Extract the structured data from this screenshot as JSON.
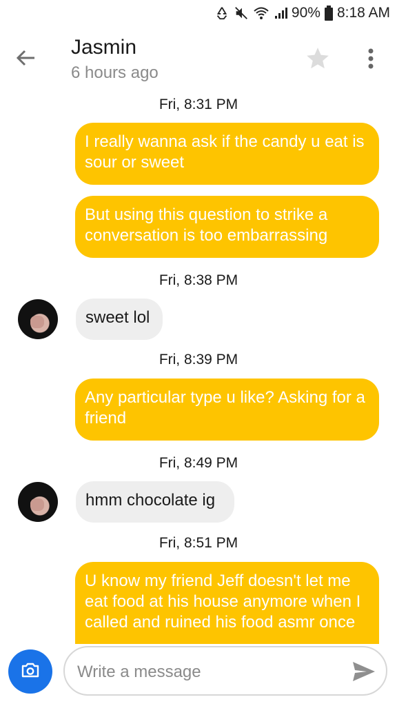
{
  "status_bar": {
    "battery": "90%",
    "time": "8:18 AM"
  },
  "header": {
    "contact_name": "Jasmin",
    "last_seen": "6 hours ago"
  },
  "messages": [
    {
      "type": "timestamp",
      "text": "Fri, 8:31 PM"
    },
    {
      "type": "outgoing",
      "text": "I really wanna ask if the candy u eat is sour or sweet"
    },
    {
      "type": "outgoing",
      "text": "But using this question to strike a conversation is too embarrassing"
    },
    {
      "type": "timestamp",
      "text": "Fri, 8:38 PM"
    },
    {
      "type": "incoming",
      "text": "sweet lol"
    },
    {
      "type": "timestamp",
      "text": "Fri, 8:39 PM"
    },
    {
      "type": "outgoing",
      "text": "Any particular type u like? Asking for a friend"
    },
    {
      "type": "timestamp",
      "text": "Fri, 8:49 PM"
    },
    {
      "type": "incoming",
      "text": "hmm chocolate ig"
    },
    {
      "type": "timestamp",
      "text": "Fri, 8:51 PM"
    },
    {
      "type": "outgoing",
      "text": "U know my friend Jeff doesn't let me eat food at his house anymore when I called and ruined his food asmr once"
    }
  ],
  "composer": {
    "placeholder": "Write a message"
  },
  "colors": {
    "outgoing_bubble": "#fec400",
    "incoming_bubble": "#eeeeee",
    "camera_button": "#1a73e8"
  }
}
